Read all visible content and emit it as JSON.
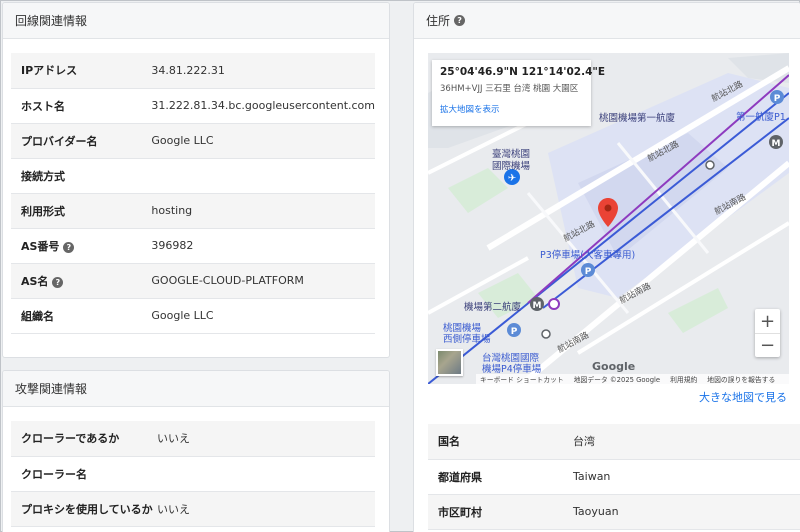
{
  "line_info": {
    "title": "回線関連情報",
    "rows": [
      {
        "label": "IPアドレス",
        "value": "34.81.222.31",
        "help": false
      },
      {
        "label": "ホスト名",
        "value": "31.222.81.34.bc.googleusercontent.com",
        "help": false
      },
      {
        "label": "プロバイダー名",
        "value": "Google LLC",
        "help": false
      },
      {
        "label": "接続方式",
        "value": "",
        "help": false
      },
      {
        "label": "利用形式",
        "value": "hosting",
        "help": false
      },
      {
        "label": "AS番号",
        "value": "396982",
        "help": true
      },
      {
        "label": "AS名",
        "value": "GOOGLE-CLOUD-PLATFORM",
        "help": true
      },
      {
        "label": "組織名",
        "value": "Google LLC",
        "help": false
      }
    ]
  },
  "attack_info": {
    "title": "攻撃関連情報",
    "rows": [
      {
        "label": "クローラーであるか",
        "value": "いいえ"
      },
      {
        "label": "クローラー名",
        "value": ""
      },
      {
        "label": "プロキシを使用しているか",
        "value": "いいえ"
      }
    ]
  },
  "address": {
    "title": "住所",
    "map": {
      "coords": "25°04'46.9\"N 121°14'02.4\"E",
      "plus_code": "36HM+VJJ 三石里 台湾 桃園 大園区",
      "enlarge_link": "拡大地図を表示",
      "labels": {
        "terminal1": "桃園機場第一航廈",
        "terminal1_short": "第一航廈P1",
        "airport_line1": "臺灣桃園",
        "airport_line2": "國際機場",
        "p3": "P3停車場(大客車專用)",
        "terminal2": "機場第二航廈",
        "west_line1": "桃園機場",
        "west_line2": "西側停車場",
        "p4_line1": "台灣桃園國際",
        "p4_line2": "機場P4停車場"
      },
      "roads": {
        "north1": "航站北路",
        "north2": "航站北路",
        "north3": "航站北路",
        "south1": "航站南路",
        "south2": "航站南路",
        "south3": "航站南路"
      },
      "zoom_in": "+",
      "zoom_out": "−",
      "logo": "Google",
      "attribution": {
        "shortcuts": "キーボード ショートカット",
        "data": "地図データ ©2025 Google",
        "terms": "利用規約",
        "report": "地図の誤りを報告する"
      }
    },
    "big_map_link": "大きな地図で見る",
    "rows": [
      {
        "label": "国名",
        "value": "台湾"
      },
      {
        "label": "都道府県",
        "value": "Taiwan"
      },
      {
        "label": "市区町村",
        "value": "Taoyuan"
      }
    ]
  },
  "colors": {
    "link": "#1a73e8",
    "pin": "#ea4335",
    "line_purple": "#8e3bbf",
    "line_blue": "#3b5bd6"
  }
}
